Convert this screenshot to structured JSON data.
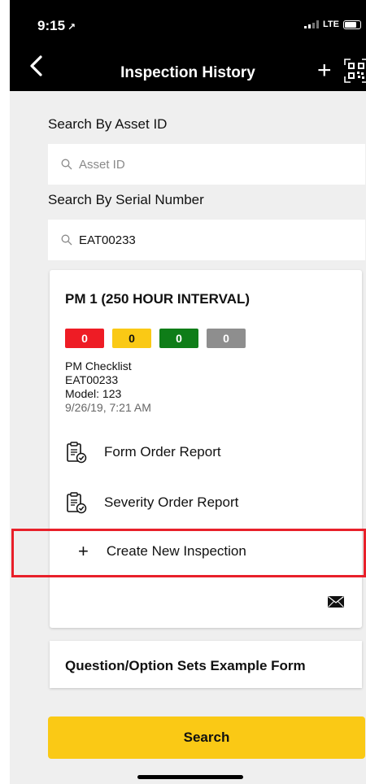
{
  "status_bar": {
    "time": "9:15",
    "location_glyph": "↗",
    "network": "LTE"
  },
  "nav": {
    "title": "Inspection History",
    "add_glyph": "+"
  },
  "search_asset": {
    "label": "Search By Asset ID",
    "placeholder": "Asset ID",
    "value": ""
  },
  "search_serial": {
    "label": "Search By Serial Number",
    "placeholder": "",
    "value": "EAT00233"
  },
  "card": {
    "title": "PM 1 (250 HOUR INTERVAL)",
    "badges": [
      {
        "count": "0",
        "color": "#ee1c25"
      },
      {
        "count": "0",
        "color": "#fac915"
      },
      {
        "count": "0",
        "color": "#0f7d18"
      },
      {
        "count": "0",
        "color": "#8e8e8e"
      }
    ],
    "checklist": "PM Checklist",
    "serial": "EAT00233",
    "model": "Model: 123",
    "date": "9/26/19, 7:21 AM",
    "form_report": "Form Order Report",
    "severity_report": "Severity Order Report",
    "create_glyph": "+",
    "create_label": "Create New Inspection"
  },
  "card2": {
    "title": "Question/Option Sets Example Form"
  },
  "search_button": {
    "label": "Search"
  },
  "colors": {
    "accent": "#fac915",
    "highlight": "#e8202a",
    "bar": "#000000"
  }
}
